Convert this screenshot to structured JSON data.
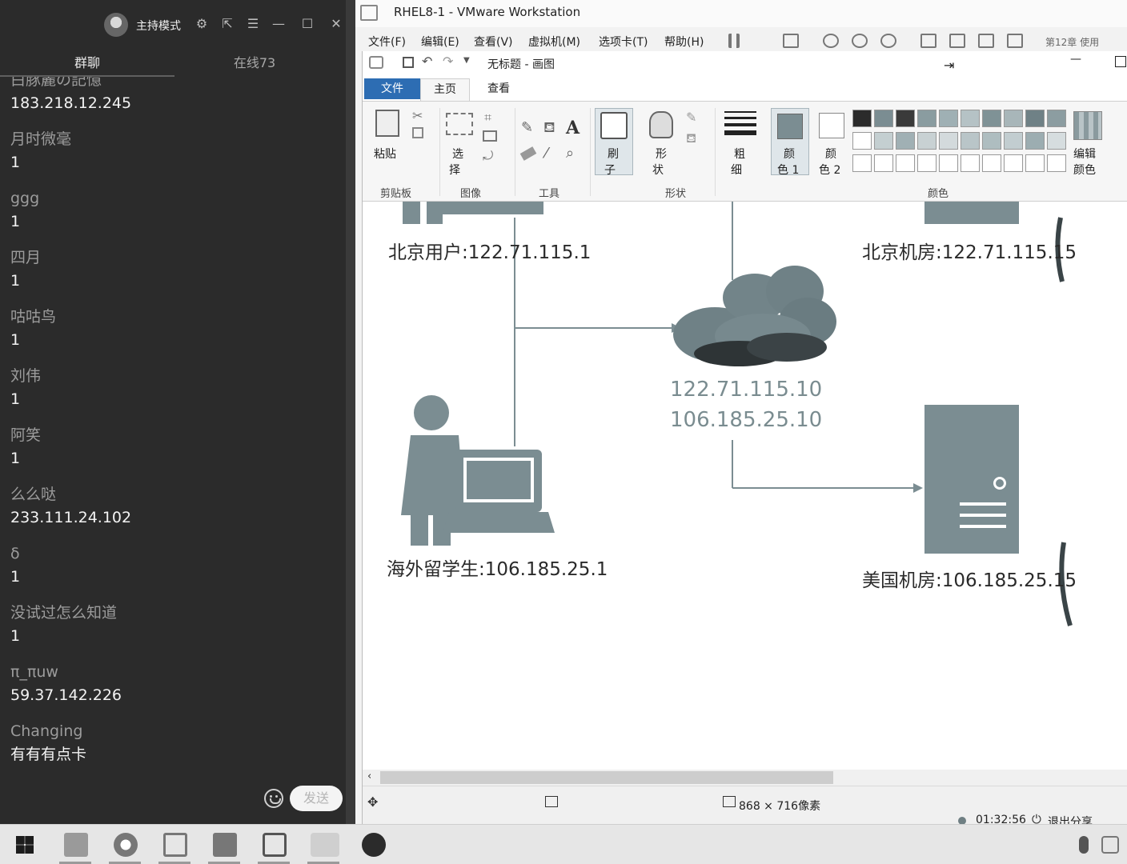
{
  "chat": {
    "mode_label": "主持模式",
    "tabs": {
      "group": "群聊",
      "online": "在线73"
    },
    "partial_top_name": "白豚麗の記憶",
    "messages": [
      {
        "name": "",
        "text": "183.218.12.245"
      },
      {
        "name": "月时微毫",
        "text": "1"
      },
      {
        "name": "ggg",
        "text": "1"
      },
      {
        "name": "四月",
        "text": "1"
      },
      {
        "name": "咕咕鸟",
        "text": "1"
      },
      {
        "name": "刘伟",
        "text": "1"
      },
      {
        "name": "阿笑",
        "text": "1"
      },
      {
        "name": "么么哒",
        "text": "233.111.24.102"
      },
      {
        "name": "δ",
        "text": "1"
      },
      {
        "name": "没试过怎么知道",
        "text": "1"
      },
      {
        "name": "π_πuw",
        "text": "59.37.142.226"
      },
      {
        "name": "Changing",
        "text": "有有有点卡"
      }
    ],
    "send_label": "发送"
  },
  "vmware": {
    "title": "RHEL8-1 - VMware Workstation",
    "menu": [
      "文件(F)",
      "编辑(E)",
      "查看(V)",
      "虚拟机(M)",
      "选项卡(T)",
      "帮助(H)"
    ],
    "right_tab_partial": "第12章 使用"
  },
  "paint": {
    "title": "无标题 - 画图",
    "tabs": {
      "file": "文件",
      "home": "主页",
      "view": "查看"
    },
    "ribbon": {
      "paste": "粘贴",
      "select_1": "选",
      "select_2": "择",
      "brush_1": "刷",
      "brush_2": "子",
      "shape_1": "形",
      "shape_2": "状",
      "size_1": "粗",
      "size_2": "细",
      "color1_1": "颜",
      "color1_2": "色 1",
      "color2_1": "颜",
      "color2_2": "色 2",
      "edit_color_1": "编辑",
      "edit_color_2": "颜色",
      "groups": {
        "clipboard": "剪贴板",
        "image": "图像",
        "tools": "工具",
        "shapes": "形状",
        "colors": "颜色"
      }
    },
    "diagram": {
      "beijing_user": "北京用户:122.71.115.1",
      "beijing_room": "北京机房:122.71.115.15",
      "cloud_ip_1": "122.71.115.10",
      "cloud_ip_2": "106.185.25.10",
      "overseas_student": "海外留学生:106.185.25.1",
      "us_room": "美国机房:106.185.25.15"
    },
    "status": {
      "size": "868 × 716像素",
      "record_time": "01:32:56",
      "exit_share": "退出分享"
    }
  },
  "colors": {
    "diagram_gray": "#7b8d92",
    "file_tab_blue": "#2d6db3",
    "chat_bg": "#2b2b2b"
  }
}
